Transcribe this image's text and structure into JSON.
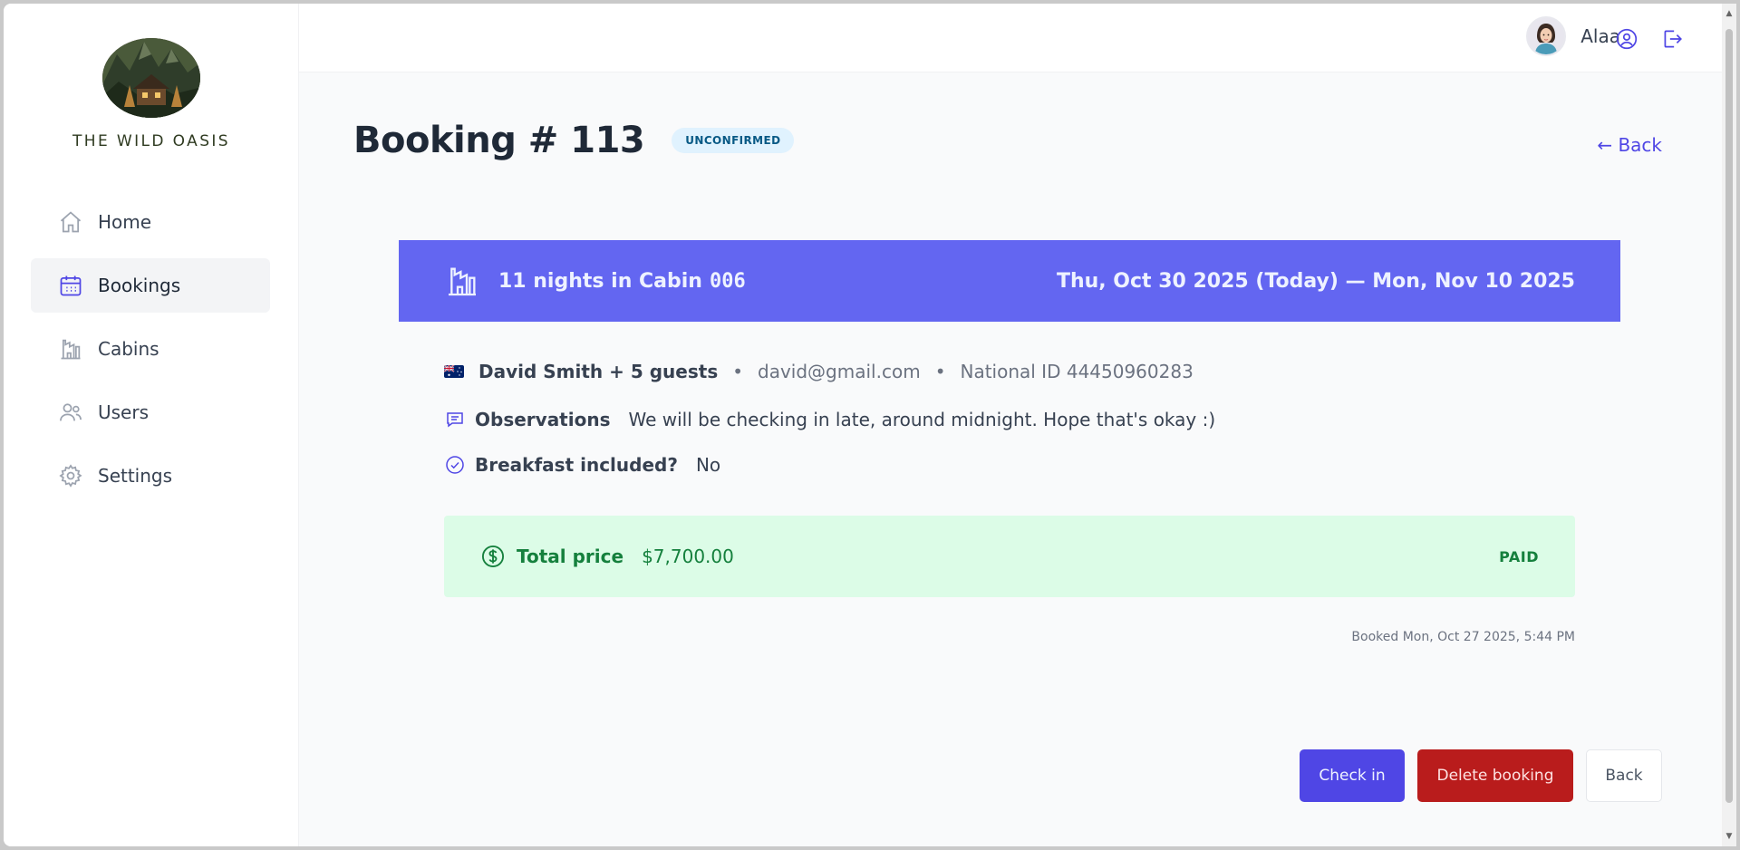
{
  "app": {
    "brand_name": "THE WILD OASIS"
  },
  "sidebar": {
    "items": [
      {
        "label": "Home",
        "icon": "home-icon",
        "active": false
      },
      {
        "label": "Bookings",
        "icon": "calendar-icon",
        "active": true
      },
      {
        "label": "Cabins",
        "icon": "building-icon",
        "active": false
      },
      {
        "label": "Users",
        "icon": "users-icon",
        "active": false
      },
      {
        "label": "Settings",
        "icon": "gear-icon",
        "active": false
      }
    ]
  },
  "header": {
    "user_name": "Alaa",
    "account_icon": "user-circle-icon",
    "logout_icon": "logout-icon"
  },
  "page": {
    "title": "Booking # 113",
    "status": "UNCONFIRMED",
    "back_link": "← Back"
  },
  "booking": {
    "nights_text": "11 nights in Cabin",
    "cabin_code": "006",
    "date_range": "Thu, Oct 30 2025 (Today) — Mon, Nov 10 2025",
    "guest_name": "David Smith + 5 guests",
    "guest_email": "david@gmail.com",
    "national_id": "National ID 44450960283",
    "separator": "•",
    "observations_label": "Observations",
    "observations_value": "We will be checking in late, around midnight. Hope that's okay :)",
    "breakfast_label": "Breakfast included?",
    "breakfast_value": "No",
    "total_price_label": "Total price",
    "total_price_value": "$7,700.00",
    "payment_status": "PAID",
    "booked_on": "Booked Mon, Oct 27 2025, 5:44 PM"
  },
  "actions": {
    "check_in": "Check in",
    "delete": "Delete booking",
    "back": "Back"
  },
  "colors": {
    "accent": "#4f46e5",
    "header_band": "#6366f1",
    "danger": "#b91c1c",
    "paid_bg": "#dcfce7",
    "paid_text": "#15803d",
    "status_bg": "#e0f2fe"
  }
}
